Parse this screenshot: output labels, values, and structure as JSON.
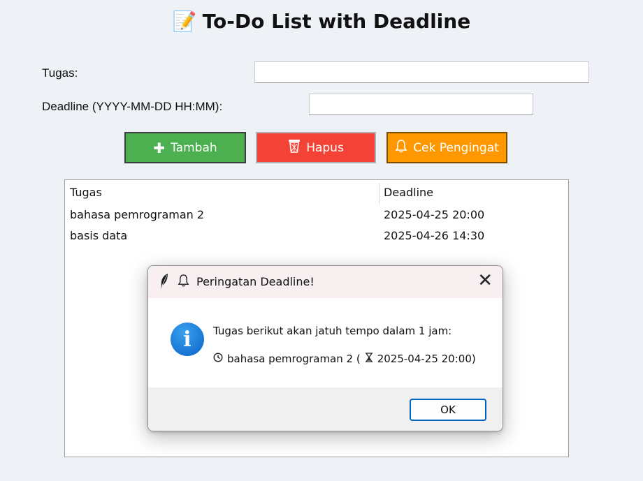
{
  "app": {
    "title_icon": "memo-icon",
    "title": "To-Do List with Deadline"
  },
  "form": {
    "task_label": "Tugas:",
    "task_value": "",
    "deadline_label": "Deadline (YYYY-MM-DD HH:MM):",
    "deadline_value": ""
  },
  "buttons": {
    "add": {
      "icon": "plus-icon",
      "label": "Tambah",
      "color": "#4caf50"
    },
    "delete": {
      "icon": "wastebasket-icon",
      "label": "Hapus",
      "color": "#f44336"
    },
    "reminder": {
      "icon": "bell-icon",
      "label": "Cek Pengingat",
      "color": "#ff9800"
    }
  },
  "table": {
    "columns": [
      "Tugas",
      "Deadline"
    ],
    "rows": [
      {
        "task": "bahasa pemrograman 2",
        "deadline": "2025-04-25 20:00"
      },
      {
        "task": "basis data",
        "deadline": "2025-04-26 14:30"
      }
    ]
  },
  "dialog": {
    "icons": [
      "feather-icon",
      "bell-icon"
    ],
    "title": "Peringatan Deadline!",
    "message_icon": "info-icon",
    "message_line1": "Tugas berikut akan jatuh tempo dalam 1 jam:",
    "message_line2": "bahasa pemrograman 2 (",
    "message_line2_deadline": "2025-04-25 20:00)",
    "ok_label": "OK"
  }
}
